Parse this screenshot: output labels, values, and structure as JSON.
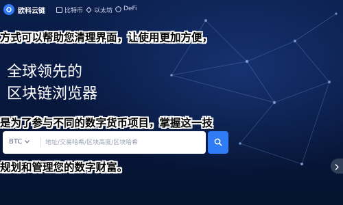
{
  "brand": {
    "name": "欧科云链"
  },
  "nav": {
    "items": [
      {
        "label": "比特币",
        "icon": "bitcoin-icon"
      },
      {
        "label": "以太坊",
        "icon": "ethereum-icon"
      },
      {
        "label": "DeFi",
        "icon": "defi-icon"
      }
    ]
  },
  "hero": {
    "line1": "全球领先的",
    "line2": "区块链浏览器"
  },
  "search": {
    "chain_selected": "BTC",
    "placeholder": "地址/交易哈希/区块高度/区块哈希"
  },
  "overlay": {
    "line1": "方式可以帮助您清理界面，让使用更加方便，",
    "line2": "是为了参与不同的数字货币项目，掌握这一技",
    "line3": "规划和管理您的数字财富。"
  },
  "colors": {
    "background": "#07163a",
    "accent": "#2f7cf6",
    "hero_text": "#ffffff"
  }
}
